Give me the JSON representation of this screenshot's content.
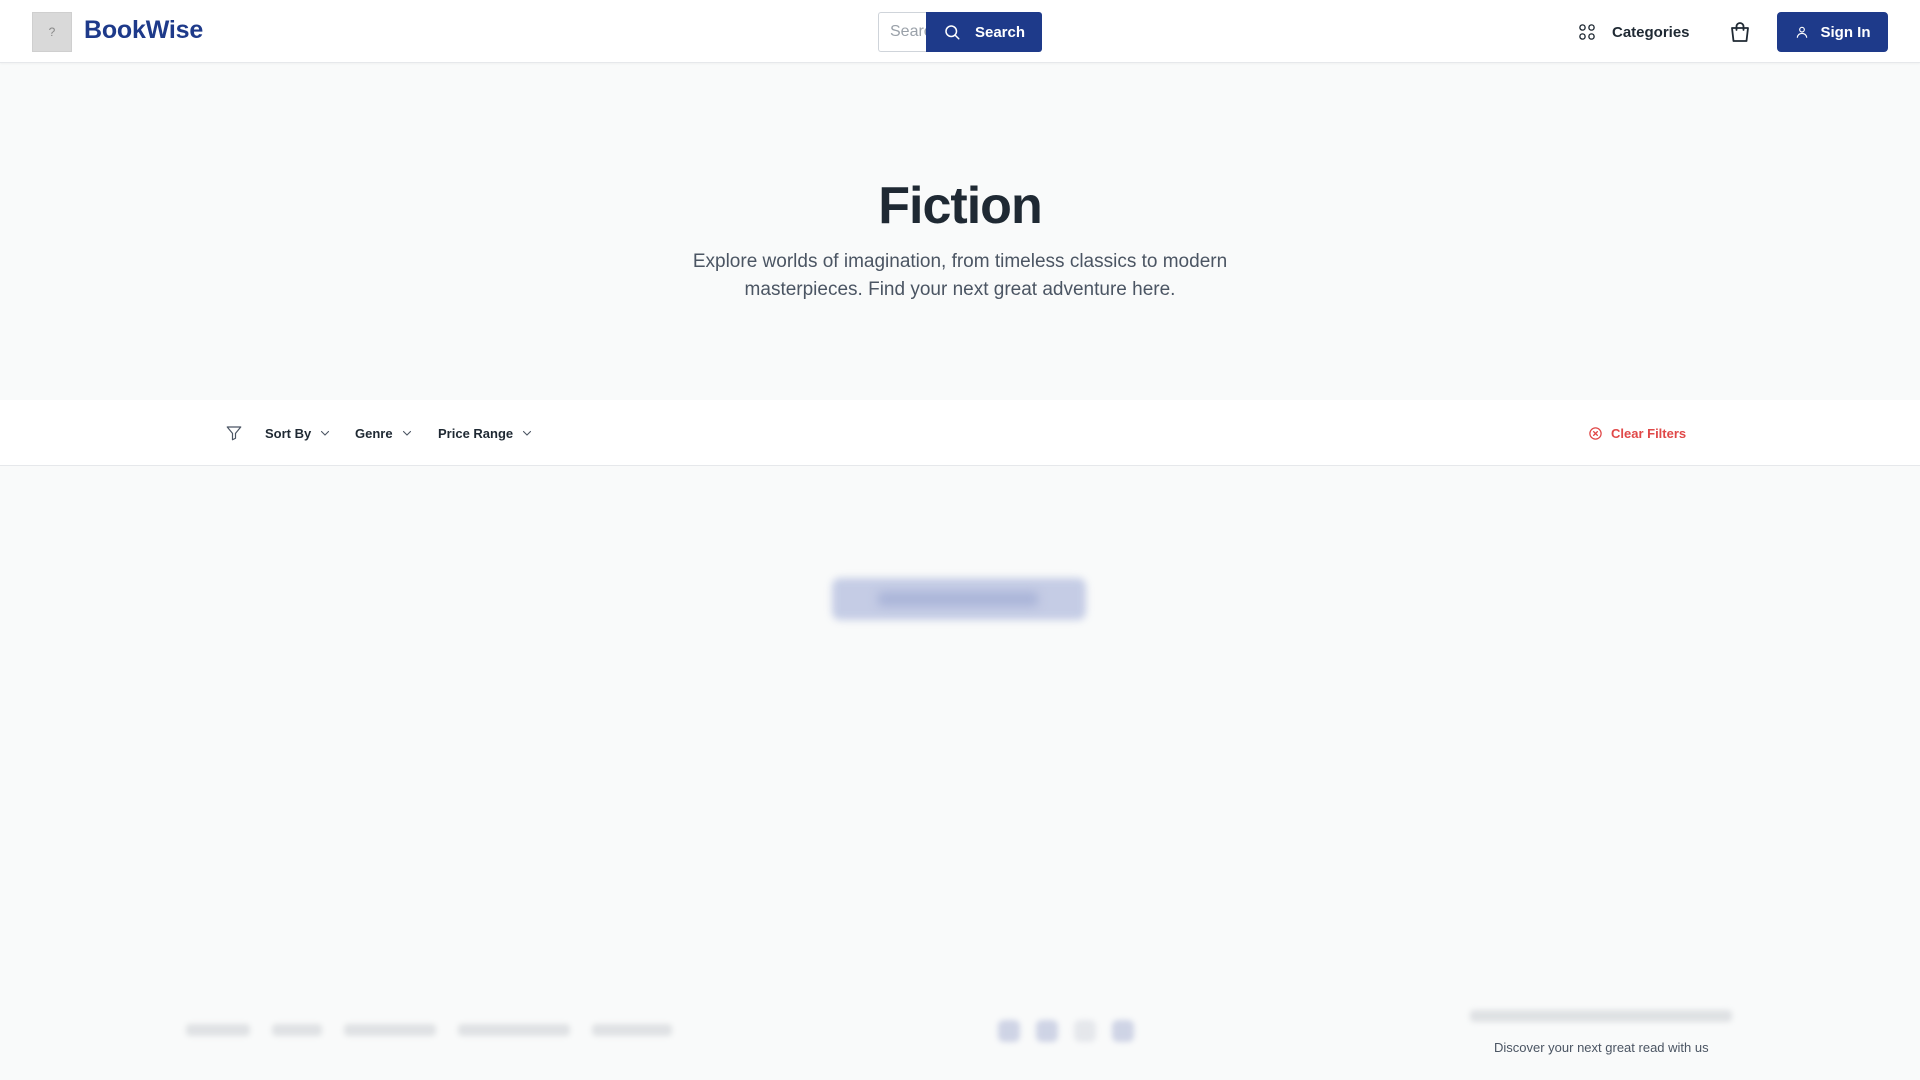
{
  "header": {
    "logo_glyph": "?",
    "brand": "BookWise",
    "search_placeholder": "Search books...",
    "search_label": "Search",
    "categories_label": "Categories",
    "signin_label": "Sign In"
  },
  "hero": {
    "title": "Fiction",
    "subtitle": "Explore worlds of imagination, from timeless classics to modern masterpieces. Find your next great adventure here."
  },
  "filters": {
    "sort_label": "Sort By",
    "genre_label": "Genre",
    "price_label": "Price Range",
    "clear_label": "Clear Filters"
  },
  "footer": {
    "tagline": "Discover your next great read with us"
  },
  "colors": {
    "brand": "#1e3a8a",
    "danger": "#e04848",
    "background": "#f9fafa"
  },
  "icons": [
    "search-icon",
    "categories-grid-icon",
    "shopping-bag-icon",
    "user-icon",
    "filter-icon",
    "chevron-down-icon",
    "clear-circle-icon"
  ]
}
